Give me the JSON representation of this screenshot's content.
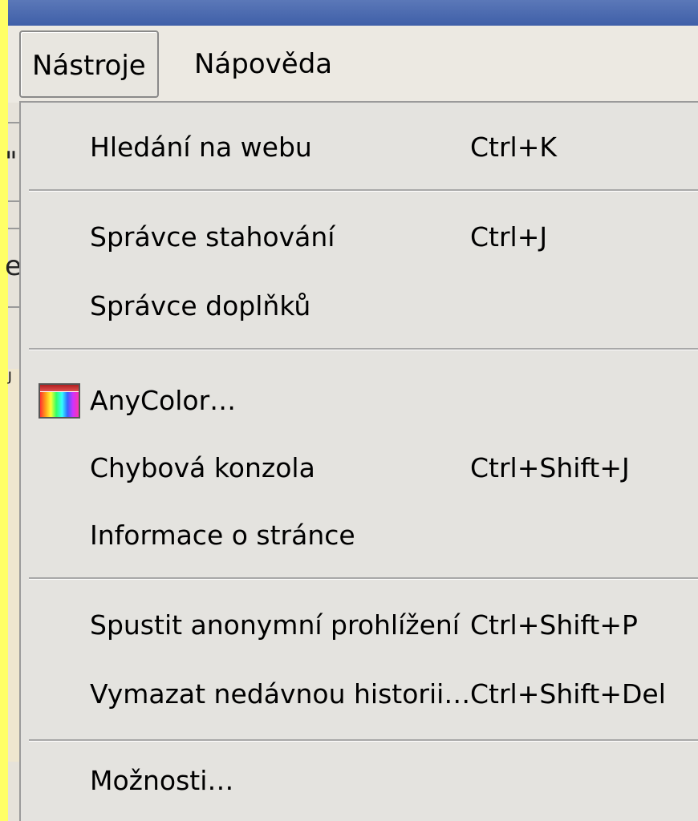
{
  "menubar": {
    "items": [
      {
        "label": "Nástroje",
        "active": true
      },
      {
        "label": "Nápověda",
        "active": false
      }
    ]
  },
  "background_window": {
    "chars": [
      "\"",
      "e",
      "J"
    ]
  },
  "menu": {
    "items": [
      {
        "type": "item",
        "label": "Hledání na webu",
        "shortcut": "Ctrl+K"
      },
      {
        "type": "separator"
      },
      {
        "type": "item",
        "label": "Správce stahování",
        "shortcut": "Ctrl+J"
      },
      {
        "type": "item",
        "label": "Správce doplňků",
        "shortcut": ""
      },
      {
        "type": "separator"
      },
      {
        "type": "item",
        "label": "AnyColor…",
        "shortcut": "",
        "icon": "anycolor-palette-icon"
      },
      {
        "type": "item",
        "label": "Chybová konzola",
        "shortcut": "Ctrl+Shift+J"
      },
      {
        "type": "item",
        "label": "Informace o stránce",
        "shortcut": ""
      },
      {
        "type": "separator"
      },
      {
        "type": "item",
        "label": "Spustit anonymní prohlížení",
        "shortcut": "Ctrl+Shift+P"
      },
      {
        "type": "item",
        "label": "Vymazat nedávnou historii…",
        "shortcut": "Ctrl+Shift+Del"
      },
      {
        "type": "separator"
      },
      {
        "type": "item",
        "label": "Možnosti…",
        "shortcut": ""
      }
    ]
  },
  "colors": {
    "slide_background": "#FFFF66",
    "menu_background": "#E4E3DF",
    "title_strip": "#3F5FA8"
  }
}
